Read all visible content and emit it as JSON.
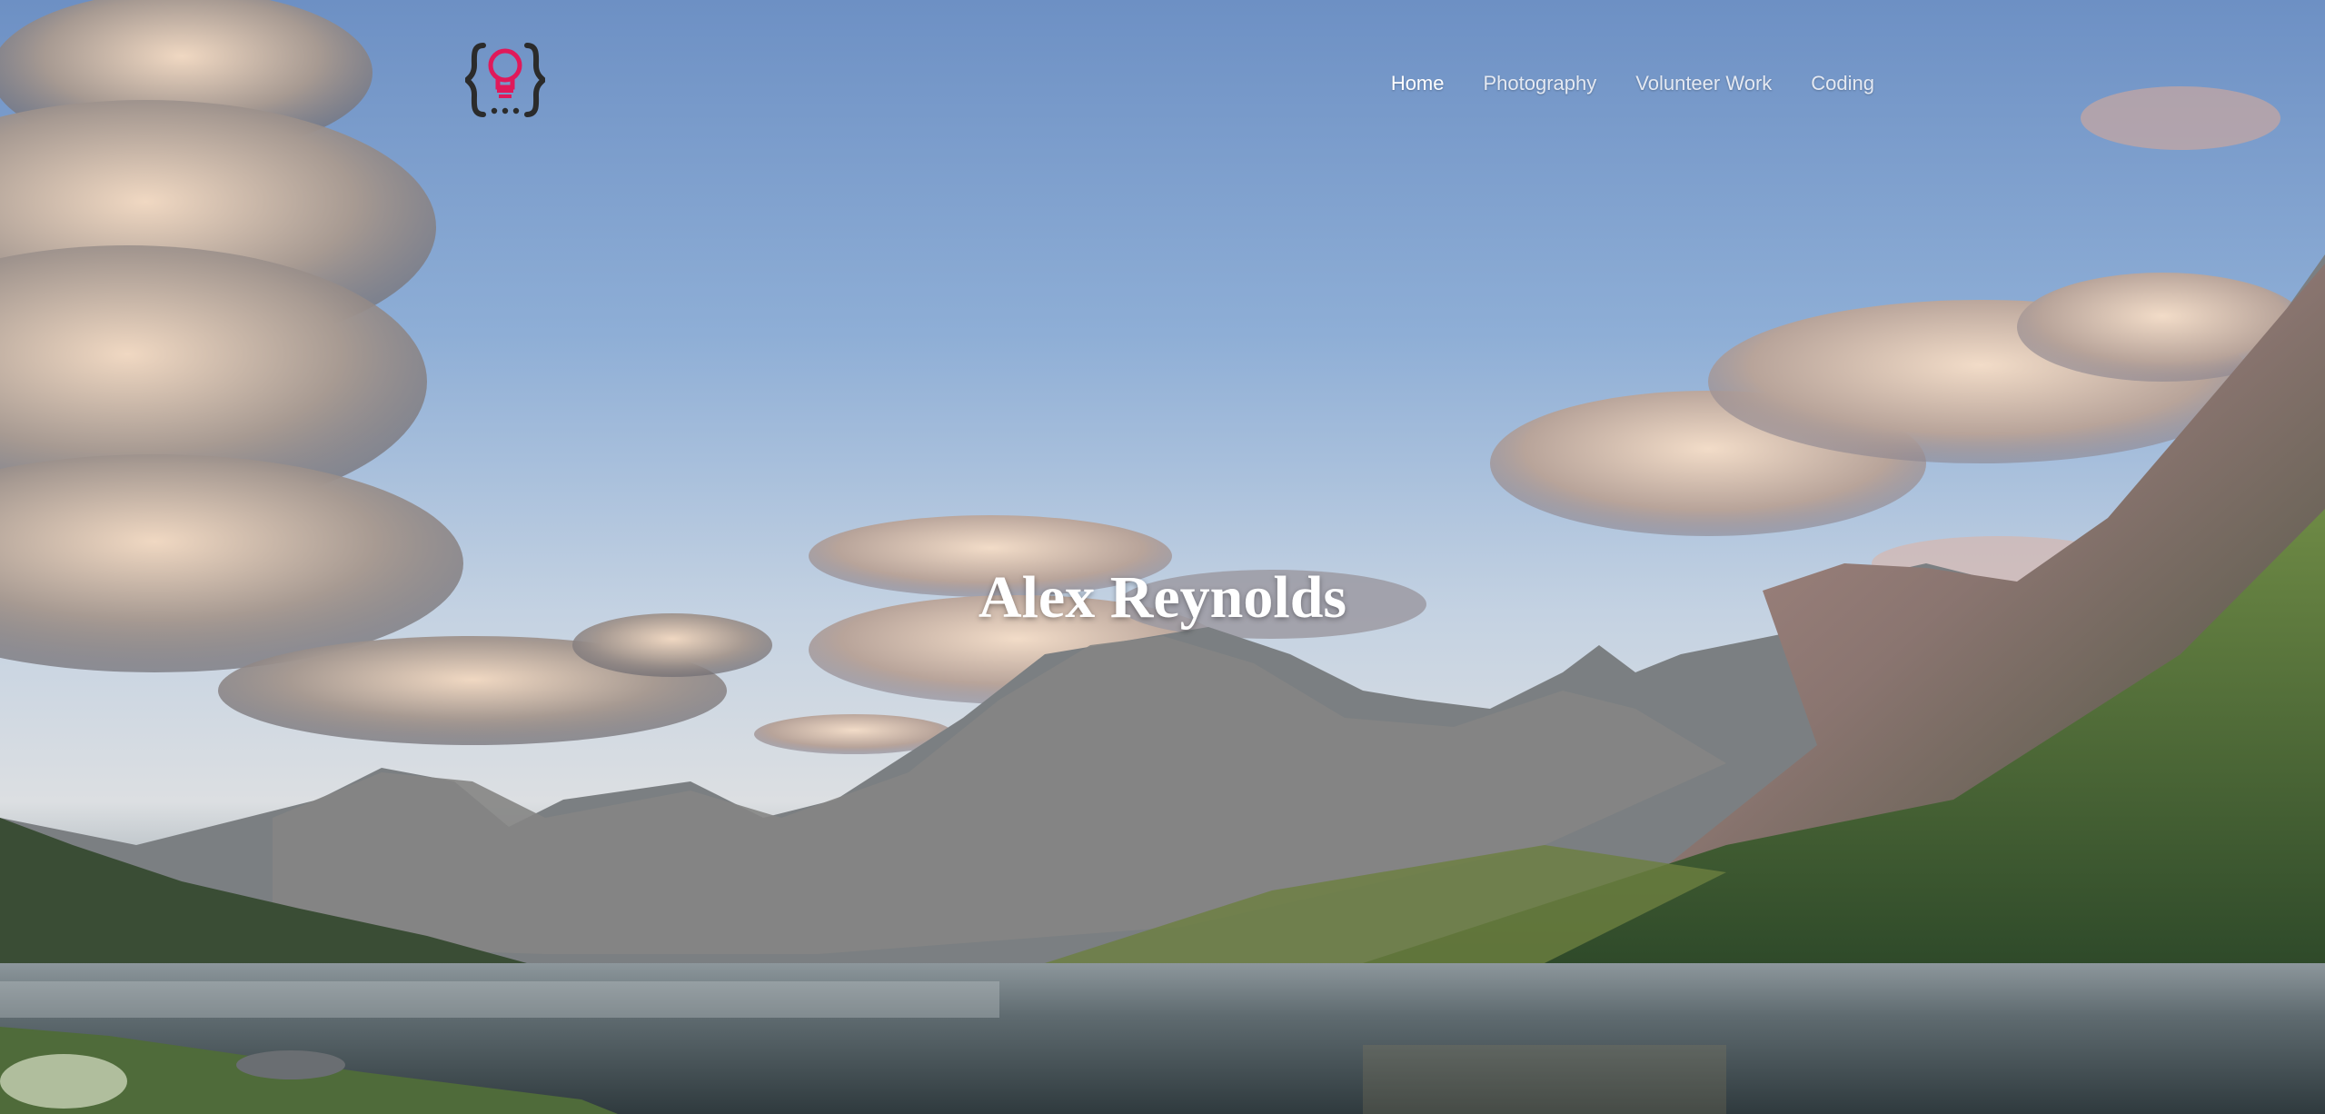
{
  "site": {
    "logo": {
      "icon": "lightbulb-braces-icon",
      "colors": {
        "braces": "#2b2b2b",
        "bulb": "#e0195a"
      }
    },
    "nav": {
      "items": [
        {
          "label": "Home",
          "active": true
        },
        {
          "label": "Photography",
          "active": false
        },
        {
          "label": "Volunteer Work",
          "active": false
        },
        {
          "label": "Coding",
          "active": false
        }
      ]
    },
    "hero": {
      "title": "Alex Reynolds",
      "background": "mountain-lake-landscape"
    }
  }
}
